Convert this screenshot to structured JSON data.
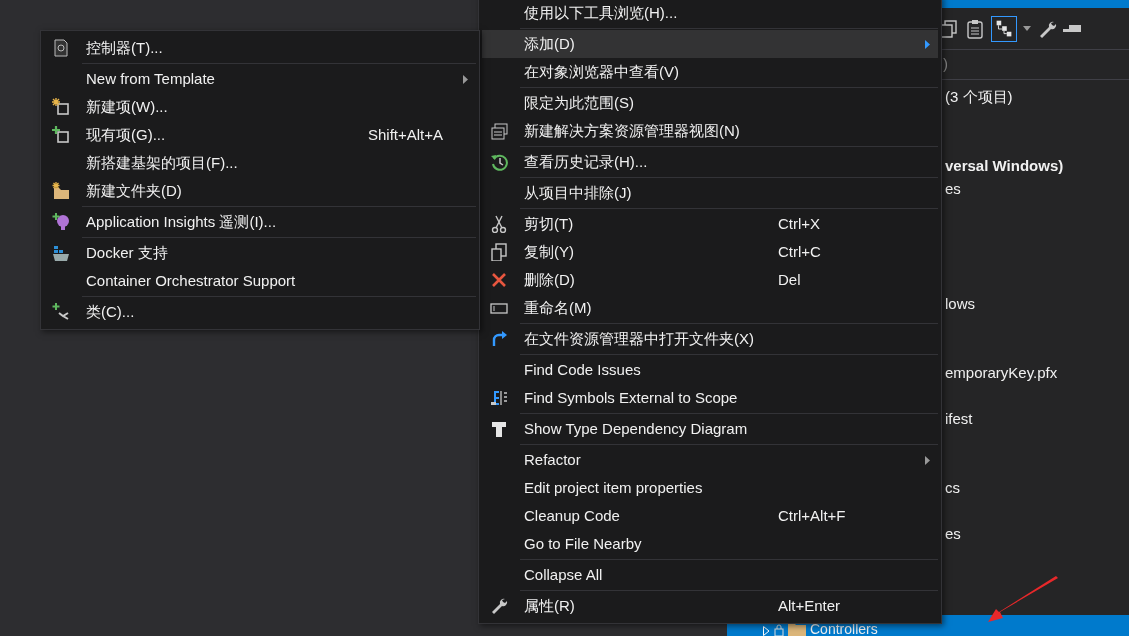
{
  "solution_explorer": {
    "search_fragment": ")",
    "tree": [
      {
        "label": "(3 个项目)",
        "bold": false,
        "selected": false
      },
      {
        "label": "versal Windows)",
        "bold": true,
        "selected": false
      },
      {
        "label": "es",
        "bold": false,
        "selected": false
      },
      {
        "label": "lows",
        "bold": false,
        "selected": false
      },
      {
        "label": "emporaryKey.pfx",
        "bold": false,
        "selected": false
      },
      {
        "label": "ifest",
        "bold": false,
        "selected": false
      },
      {
        "label": "cs",
        "bold": false,
        "selected": false
      },
      {
        "label": "es",
        "bold": false,
        "selected": false
      },
      {
        "label": "Controllers",
        "bold": false,
        "selected": true
      }
    ]
  },
  "context_menu": {
    "items": [
      {
        "kind": "item",
        "label": "使用以下工具浏览(H)...",
        "selected": false,
        "has_submenu": false
      },
      {
        "kind": "separator"
      },
      {
        "kind": "item",
        "label": "添加(D)",
        "selected": true,
        "has_submenu": true
      },
      {
        "kind": "item",
        "label": "在对象浏览器中查看(V)",
        "selected": false,
        "has_submenu": false
      },
      {
        "kind": "separator"
      },
      {
        "kind": "item",
        "label": "限定为此范围(S)",
        "selected": false,
        "has_submenu": false
      },
      {
        "kind": "item",
        "label": "新建解决方案资源管理器视图(N)",
        "selected": false,
        "has_submenu": false
      },
      {
        "kind": "separator"
      },
      {
        "kind": "item",
        "label": "查看历史记录(H)...",
        "selected": false,
        "has_submenu": false
      },
      {
        "kind": "separator"
      },
      {
        "kind": "item",
        "label": "从项目中排除(J)",
        "selected": false,
        "has_submenu": false
      },
      {
        "kind": "separator"
      },
      {
        "kind": "item",
        "label": "剪切(T)",
        "shortcut": "Ctrl+X",
        "selected": false,
        "has_submenu": false
      },
      {
        "kind": "item",
        "label": "复制(Y)",
        "shortcut": "Ctrl+C",
        "selected": false,
        "has_submenu": false
      },
      {
        "kind": "item",
        "label": "删除(D)",
        "shortcut": "Del",
        "selected": false,
        "has_submenu": false
      },
      {
        "kind": "item",
        "label": "重命名(M)",
        "selected": false,
        "has_submenu": false
      },
      {
        "kind": "separator"
      },
      {
        "kind": "item",
        "label": "在文件资源管理器中打开文件夹(X)",
        "selected": false,
        "has_submenu": false
      },
      {
        "kind": "separator"
      },
      {
        "kind": "item",
        "label": "Find Code Issues",
        "selected": false,
        "has_submenu": false
      },
      {
        "kind": "item",
        "label": "Find Symbols External to Scope",
        "selected": false,
        "has_submenu": false
      },
      {
        "kind": "separator"
      },
      {
        "kind": "item",
        "label": "Show Type Dependency Diagram",
        "selected": false,
        "has_submenu": false
      },
      {
        "kind": "separator"
      },
      {
        "kind": "item",
        "label": "Refactor",
        "selected": false,
        "has_submenu": true
      },
      {
        "kind": "item",
        "label": "Edit project item properties",
        "selected": false,
        "has_submenu": false
      },
      {
        "kind": "item",
        "label": "Cleanup Code",
        "shortcut": "Ctrl+Alt+F",
        "selected": false,
        "has_submenu": false
      },
      {
        "kind": "item",
        "label": "Go to File Nearby",
        "selected": false,
        "has_submenu": false
      },
      {
        "kind": "separator"
      },
      {
        "kind": "item",
        "label": "Collapse All",
        "selected": false,
        "has_submenu": false
      },
      {
        "kind": "separator"
      },
      {
        "kind": "item",
        "label": "属性(R)",
        "shortcut": "Alt+Enter",
        "selected": false,
        "has_submenu": false
      }
    ]
  },
  "add_submenu": {
    "items": [
      {
        "kind": "item",
        "label": "控制器(T)...",
        "selected": false,
        "has_submenu": false
      },
      {
        "kind": "separator"
      },
      {
        "kind": "item",
        "label": "New from Template",
        "selected": false,
        "has_submenu": true
      },
      {
        "kind": "item",
        "label": "新建项(W)...",
        "selected": false,
        "has_submenu": false
      },
      {
        "kind": "item",
        "label": "现有项(G)...",
        "shortcut": "Shift+Alt+A",
        "selected": false,
        "has_submenu": false
      },
      {
        "kind": "item",
        "label": "新搭建基架的项目(F)...",
        "selected": false,
        "has_submenu": false
      },
      {
        "kind": "item",
        "label": "新建文件夹(D)",
        "selected": false,
        "has_submenu": false
      },
      {
        "kind": "separator"
      },
      {
        "kind": "item",
        "label": "Application Insights 遥测(I)...",
        "selected": false,
        "has_submenu": false
      },
      {
        "kind": "separator"
      },
      {
        "kind": "item",
        "label": "Docker 支持",
        "selected": false,
        "has_submenu": false
      },
      {
        "kind": "item",
        "label": "Container Orchestrator Support",
        "selected": false,
        "has_submenu": false
      },
      {
        "kind": "separator"
      },
      {
        "kind": "item",
        "label": "类(C)...",
        "selected": false,
        "has_submenu": false
      }
    ]
  }
}
